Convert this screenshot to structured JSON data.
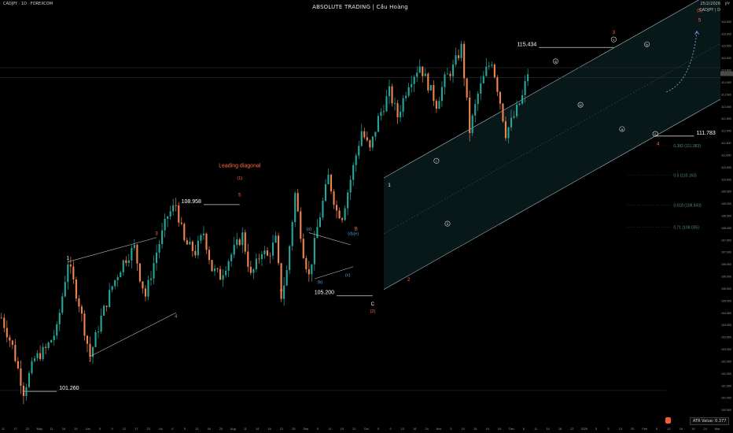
{
  "header": {
    "symbol_line": "CADJPY · 1D · FOREXCOM",
    "title": "ABSOLUTE TRADING | Cầu Hoàng",
    "date": "25/2/2026",
    "ticker_small": "CADJPY | D",
    "currency": "JPY"
  },
  "atr": {
    "label": "ATR Value: 0.377"
  },
  "colors": {
    "up": "#26a69a",
    "down": "#f0844f",
    "wave_orange": "#ff6a3d",
    "wave_blue": "#5b9bd5",
    "channel_fill": "#0f2a2c",
    "channel_line": "#9fb9c2",
    "fib_label": "#4c8a84",
    "label_white": "#ffffff"
  },
  "chart_data": {
    "type": "candlestick",
    "ylim": [
      100.0,
      117.0
    ],
    "y_axis_ticks": [
      "100.500",
      "101.000",
      "101.500",
      "102.000",
      "102.500",
      "103.000",
      "103.500",
      "104.000",
      "104.500",
      "105.000",
      "105.500",
      "106.000",
      "106.500",
      "107.000",
      "107.500",
      "108.000",
      "108.500",
      "109.000",
      "109.500",
      "110.000",
      "110.500",
      "111.000",
      "111.500",
      "112.000",
      "112.500",
      "113.000",
      "113.500",
      "114.000",
      "114.500",
      "115.000",
      "115.500",
      "116.000",
      "116.500"
    ],
    "x_axis_ticks": [
      "11",
      "17",
      "23",
      "May",
      "11",
      "16",
      "19",
      "Jun",
      "5",
      "9",
      "12",
      "17",
      "23",
      "Jul",
      "6",
      "9",
      "13",
      "16",
      "20",
      "Aug",
      "11",
      "14",
      "18",
      "21",
      "25",
      "Sep",
      "5",
      "11",
      "15",
      "21",
      "Oct",
      "5",
      "9",
      "13",
      "16",
      "24",
      "Nov",
      "5",
      "10",
      "15",
      "19",
      "24",
      "Dec",
      "6",
      "11",
      "14",
      "18",
      "22",
      "2026",
      "5",
      "9",
      "13",
      "20",
      "Feb",
      "6",
      "12",
      "16",
      "19",
      "24",
      "Mar"
    ],
    "price_path": [
      [
        0,
        104.3
      ],
      [
        4,
        103.1
      ],
      [
        8,
        101.26
      ],
      [
        12,
        102.6
      ],
      [
        16,
        103.0
      ],
      [
        20,
        103.8
      ],
      [
        24,
        106.6
      ],
      [
        28,
        104.9
      ],
      [
        32,
        102.7
      ],
      [
        36,
        104.3
      ],
      [
        40,
        105.6
      ],
      [
        44,
        106.6
      ],
      [
        48,
        107.2
      ],
      [
        50,
        106.0
      ],
      [
        52,
        105.2
      ],
      [
        56,
        107.0
      ],
      [
        60,
        108.5
      ],
      [
        63,
        108.958
      ],
      [
        66,
        107.4
      ],
      [
        70,
        107.0
      ],
      [
        73,
        107.8
      ],
      [
        76,
        106.3
      ],
      [
        79,
        106.0
      ],
      [
        82,
        106.7
      ],
      [
        85,
        107.3
      ],
      [
        87,
        107.7
      ],
      [
        90,
        106.0
      ],
      [
        92,
        106.5
      ],
      [
        94,
        107.1
      ],
      [
        96,
        106.8
      ],
      [
        99,
        107.5
      ],
      [
        101,
        105.2
      ],
      [
        103,
        106.2
      ],
      [
        106,
        109.4
      ],
      [
        109,
        107.0
      ],
      [
        111,
        106.0
      ],
      [
        114,
        108.0
      ],
      [
        118,
        110.1
      ],
      [
        121,
        108.7
      ],
      [
        123,
        108.5
      ],
      [
        126,
        110.0
      ],
      [
        130,
        112.0
      ],
      [
        133,
        111.2
      ],
      [
        136,
        112.5
      ],
      [
        140,
        113.6
      ],
      [
        143,
        112.6
      ],
      [
        147,
        114.0
      ],
      [
        151,
        114.7
      ],
      [
        154,
        113.9
      ],
      [
        157,
        113.1
      ],
      [
        160,
        114.1
      ],
      [
        163,
        114.6
      ],
      [
        166,
        115.434
      ],
      [
        169,
        112.0
      ],
      [
        172,
        113.5
      ],
      [
        175,
        114.5
      ],
      [
        177,
        114.9
      ],
      [
        180,
        113.2
      ],
      [
        182,
        111.9
      ],
      [
        185,
        112.6
      ],
      [
        188,
        113.4
      ],
      [
        190,
        114.4
      ]
    ],
    "horizontal_levels": [
      {
        "label": "115.434",
        "value": 115.434
      },
      {
        "label": "111.783",
        "value": 111.783
      },
      {
        "label": "108.958",
        "value": 108.958
      },
      {
        "label": "105.200",
        "value": 105.2
      },
      {
        "label": "101.260",
        "value": 101.26
      }
    ],
    "fib_levels": [
      {
        "label": "0.382 (111.383)",
        "value": 111.383
      },
      {
        "label": "0.5 (110.163)",
        "value": 110.163
      },
      {
        "label": "0.618 (108.943)",
        "value": 108.943
      },
      {
        "label": "0.71 (108.035)",
        "value": 108.035
      }
    ],
    "wave_labels": [
      {
        "text": "1",
        "x": 24,
        "y": 106.6,
        "color": "white",
        "pos": "above"
      },
      {
        "text": "2",
        "x": 32,
        "y": 102.7,
        "color": "orange",
        "pos": "below"
      },
      {
        "text": "3",
        "x": 56,
        "y": 107.6,
        "color": "orange",
        "pos": "above"
      },
      {
        "text": "4",
        "x": 63,
        "y": 104.5,
        "color": "orange",
        "pos": "below"
      },
      {
        "text": "5",
        "x": 86,
        "y": 109.2,
        "color": "orange",
        "pos": "above"
      },
      {
        "text": "(1)",
        "x": 86,
        "y": 109.9,
        "color": "orange",
        "pos": "above"
      },
      {
        "text": "Leading diagonal",
        "x": 86,
        "y": 110.4,
        "color": "orange",
        "pos": "above"
      },
      {
        "text": "A",
        "x": 101,
        "y": 105.6,
        "color": "orange",
        "pos": "below"
      },
      {
        "text": "(a)",
        "x": 111,
        "y": 107.8,
        "color": "blue",
        "pos": "above"
      },
      {
        "text": "(b)",
        "x": 115,
        "y": 105.9,
        "color": "blue",
        "pos": "below"
      },
      {
        "text": "(c)",
        "x": 125,
        "y": 106.2,
        "color": "blue",
        "pos": "below"
      },
      {
        "text": "(d)",
        "x": 126,
        "y": 107.6,
        "color": "blue",
        "pos": "above"
      },
      {
        "text": "(e)",
        "x": 128,
        "y": 107.6,
        "color": "blue",
        "pos": "above"
      },
      {
        "text": "B",
        "x": 128,
        "y": 107.8,
        "color": "orange",
        "pos": "above"
      },
      {
        "text": "C",
        "x": 134,
        "y": 105.0,
        "color": "white",
        "pos": "below"
      },
      {
        "text": "(2)",
        "x": 134,
        "y": 104.7,
        "color": "orange",
        "pos": "below"
      },
      {
        "text": "1",
        "x": 140,
        "y": 109.6,
        "color": "white",
        "pos": "above"
      },
      {
        "text": "2",
        "x": 147,
        "y": 106.0,
        "color": "orange",
        "pos": "below"
      },
      {
        "text": "i",
        "x": 157,
        "y": 110.6,
        "color": "circle",
        "pos": "above"
      },
      {
        "text": "ii",
        "x": 161,
        "y": 108.3,
        "color": "circle",
        "pos": "below"
      },
      {
        "text": "iii",
        "x": 200,
        "y": 114.7,
        "color": "circle",
        "pos": "above"
      },
      {
        "text": "iv",
        "x": 209,
        "y": 113.2,
        "color": "circle",
        "pos": "below"
      },
      {
        "text": "v",
        "x": 221,
        "y": 115.6,
        "color": "circle",
        "pos": "above"
      },
      {
        "text": "3",
        "x": 221,
        "y": 115.9,
        "color": "orange",
        "pos": "above"
      },
      {
        "text": "a",
        "x": 224,
        "y": 112.2,
        "color": "circle",
        "pos": "below"
      },
      {
        "text": "b",
        "x": 233,
        "y": 115.4,
        "color": "circle",
        "pos": "above"
      },
      {
        "text": "c",
        "x": 236,
        "y": 112.0,
        "color": "circle",
        "pos": "below"
      },
      {
        "text": "4",
        "x": 237,
        "y": 111.6,
        "color": "orange",
        "pos": "below"
      },
      {
        "text": "(3)",
        "x": 252,
        "y": 116.8,
        "color": "orange",
        "pos": "above"
      },
      {
        "text": "5",
        "x": 252,
        "y": 116.4,
        "color": "orange",
        "pos": "above"
      }
    ],
    "grid": false
  }
}
